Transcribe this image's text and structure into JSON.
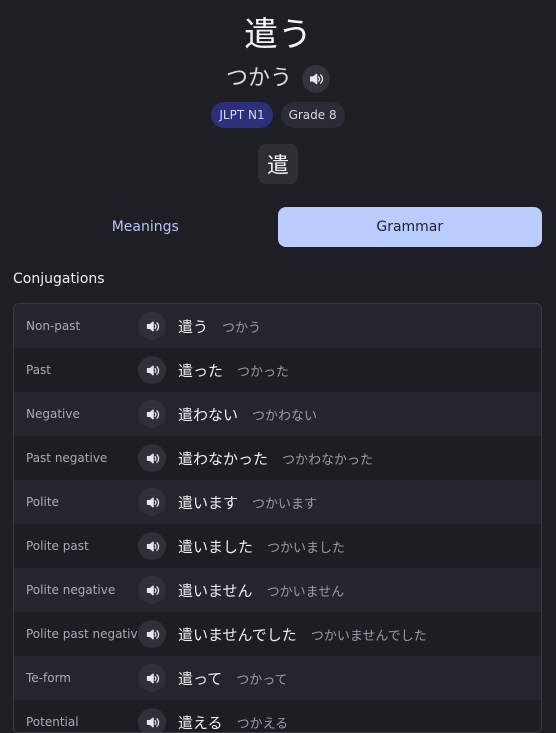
{
  "entry": {
    "kanji": "遣う",
    "reading": "つかう",
    "badges": {
      "jlpt": "JLPT N1",
      "grade": "Grade 8"
    },
    "component": "遣"
  },
  "tabs": [
    {
      "label": "Meanings",
      "active": false
    },
    {
      "label": "Grammar",
      "active": true
    }
  ],
  "section_title": "Conjugations",
  "icons": {
    "speaker": "speaker-icon"
  },
  "colors": {
    "background": "#1e1f24",
    "active_tab": "#b9ccfb",
    "jlpt_badge": "#2e2f7a"
  },
  "conjugations": [
    {
      "label": "Non-past",
      "form": "遣う",
      "kana": "つかう"
    },
    {
      "label": "Past",
      "form": "遣った",
      "kana": "つかった"
    },
    {
      "label": "Negative",
      "form": "遣わない",
      "kana": "つかわない"
    },
    {
      "label": "Past negative",
      "form": "遣わなかった",
      "kana": "つかわなかった"
    },
    {
      "label": "Polite",
      "form": "遣います",
      "kana": "つかいます"
    },
    {
      "label": "Polite past",
      "form": "遣いました",
      "kana": "つかいました"
    },
    {
      "label": "Polite negative",
      "form": "遣いません",
      "kana": "つかいません"
    },
    {
      "label": "Polite past negative",
      "form": "遣いませんでした",
      "kana": "つかいませんでした"
    },
    {
      "label": "Te-form",
      "form": "遣って",
      "kana": "つかって"
    },
    {
      "label": "Potential",
      "form": "遣える",
      "kana": "つかえる"
    }
  ]
}
